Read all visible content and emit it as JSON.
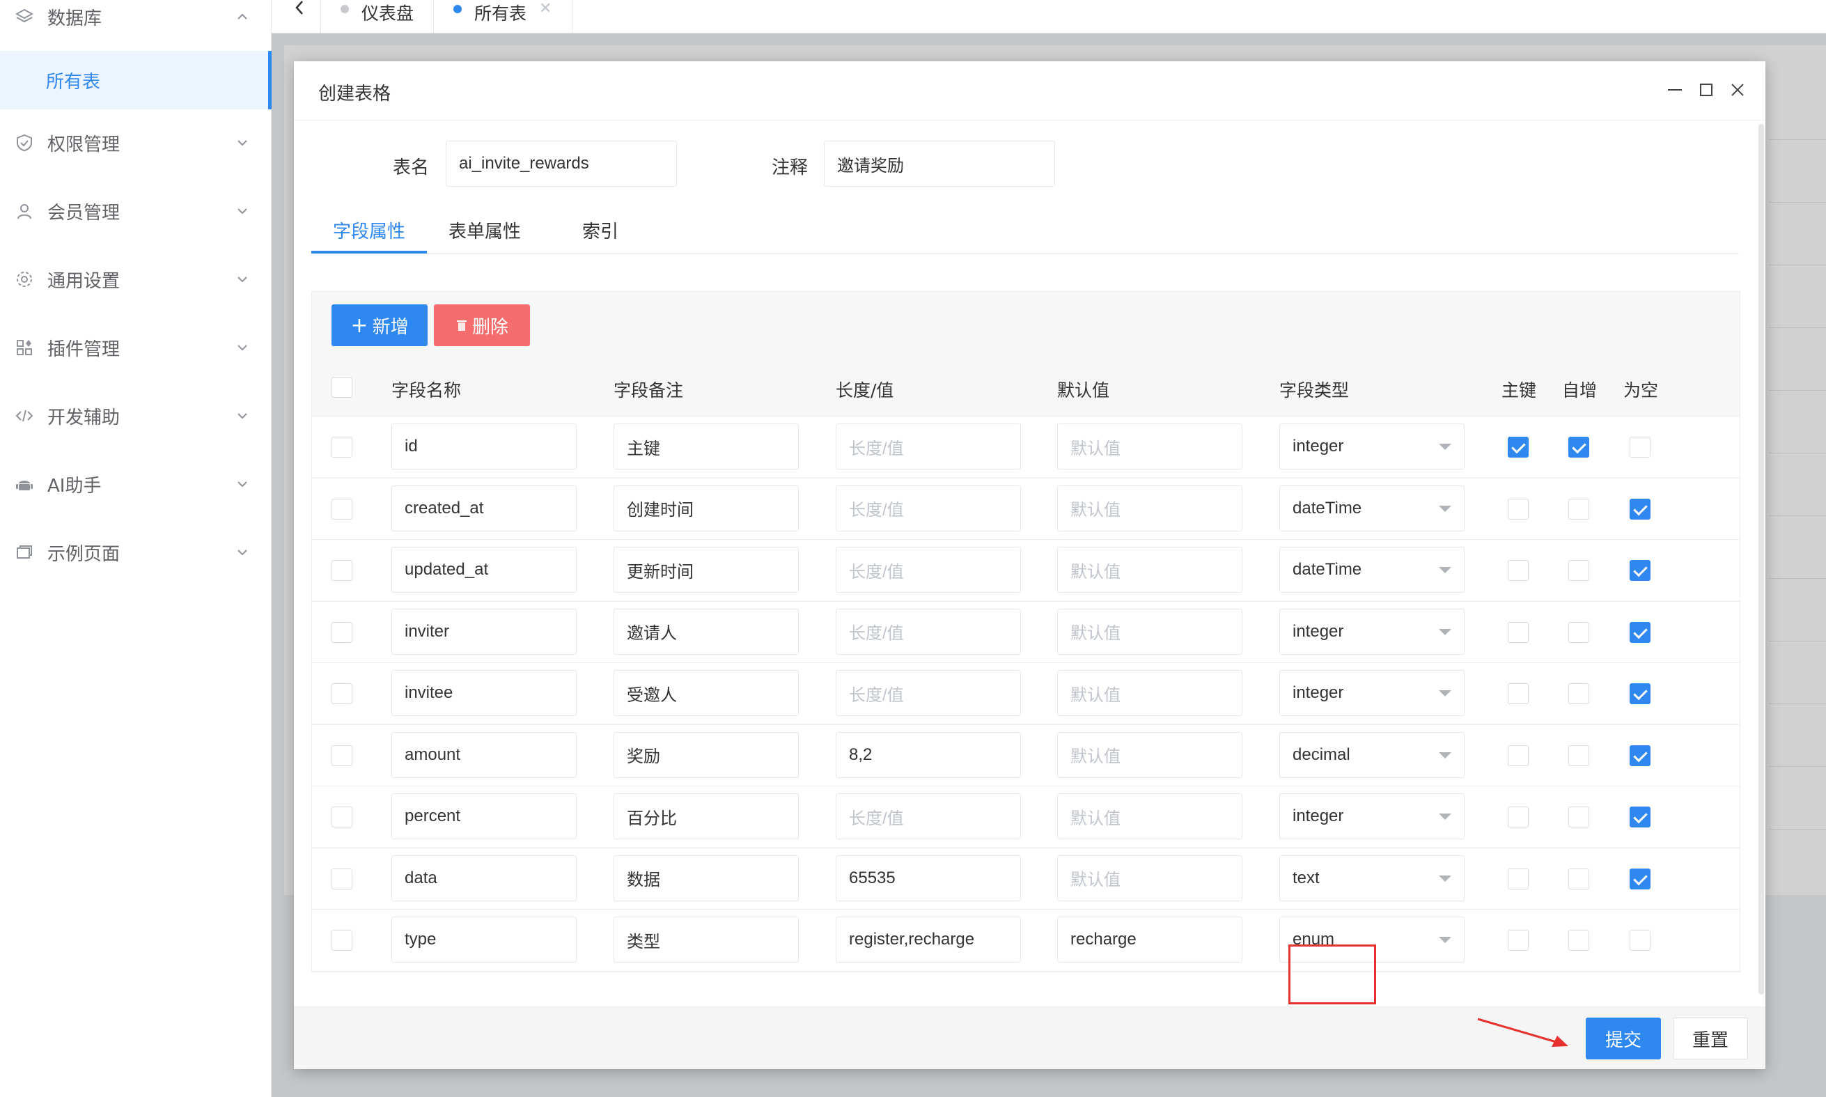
{
  "sidebar": {
    "items": [
      {
        "label": "数据库",
        "icon": "layers-icon",
        "expanded": true
      },
      {
        "label": "所有表",
        "active": true
      },
      {
        "label": "权限管理",
        "icon": "shield-icon"
      },
      {
        "label": "会员管理",
        "icon": "user-icon"
      },
      {
        "label": "通用设置",
        "icon": "gear-icon"
      },
      {
        "label": "插件管理",
        "icon": "apps-icon"
      },
      {
        "label": "开发辅助",
        "icon": "code-icon"
      },
      {
        "label": "AI助手",
        "icon": "android-icon"
      },
      {
        "label": "示例页面",
        "icon": "window-icon"
      }
    ]
  },
  "tabs": [
    {
      "label": "仪表盘",
      "dot_color": "#c8c9cc"
    },
    {
      "label": "所有表",
      "dot_color": "#2f88f0",
      "active": true
    }
  ],
  "dialog": {
    "title": "创建表格",
    "table_name_label": "表名",
    "table_name_value": "ai_invite_rewards",
    "comment_label": "注释",
    "comment_value": "邀请奖励",
    "tabs": [
      "字段属性",
      "表单属性",
      "索引"
    ],
    "add_button": "新增",
    "delete_button": "删除",
    "columns": [
      "字段名称",
      "字段备注",
      "长度/值",
      "默认值",
      "字段类型",
      "主键",
      "自增",
      "为空"
    ],
    "length_placeholder": "长度/值",
    "default_placeholder": "默认值",
    "rows": [
      {
        "name": "id",
        "comment": "主键",
        "length": "",
        "default": "",
        "type": "integer",
        "primary": true,
        "auto": true,
        "nullable": false
      },
      {
        "name": "created_at",
        "comment": "创建时间",
        "length": "",
        "default": "",
        "type": "dateTime",
        "primary": false,
        "auto": false,
        "nullable": true
      },
      {
        "name": "updated_at",
        "comment": "更新时间",
        "length": "",
        "default": "",
        "type": "dateTime",
        "primary": false,
        "auto": false,
        "nullable": true
      },
      {
        "name": "inviter",
        "comment": "邀请人",
        "length": "",
        "default": "",
        "type": "integer",
        "primary": false,
        "auto": false,
        "nullable": true
      },
      {
        "name": "invitee",
        "comment": "受邀人",
        "length": "",
        "default": "",
        "type": "integer",
        "primary": false,
        "auto": false,
        "nullable": true
      },
      {
        "name": "amount",
        "comment": "奖励",
        "length": "8,2",
        "default": "",
        "type": "decimal",
        "primary": false,
        "auto": false,
        "nullable": true
      },
      {
        "name": "percent",
        "comment": "百分比",
        "length": "",
        "default": "",
        "type": "integer",
        "primary": false,
        "auto": false,
        "nullable": true
      },
      {
        "name": "data",
        "comment": "数据",
        "length": "65535",
        "default": "",
        "type": "text",
        "primary": false,
        "auto": false,
        "nullable": true
      },
      {
        "name": "type",
        "comment": "类型",
        "length": "register,recharge",
        "default": "recharge",
        "type": "enum",
        "primary": false,
        "auto": false,
        "nullable": false
      }
    ],
    "submit_button": "提交",
    "reset_button": "重置"
  },
  "colors": {
    "accent": "#2f88f0",
    "danger": "#f56c6c",
    "annotation": "#e8312f"
  }
}
